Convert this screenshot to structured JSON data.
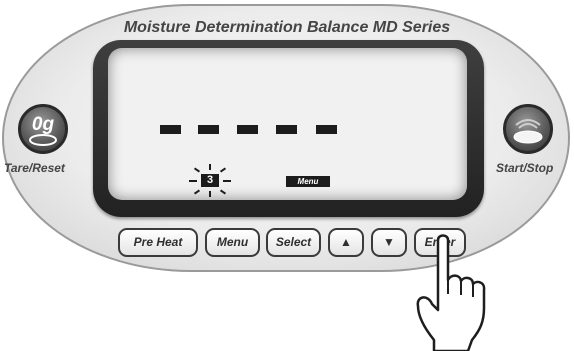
{
  "panel": {
    "title": "Moisture Determination Balance  MD Series"
  },
  "display": {
    "readout": "- - - - -",
    "program_number": "3",
    "menu_indicator": "Menu"
  },
  "left_button": {
    "icon_text": "0g",
    "label": "Tare/Reset"
  },
  "right_button": {
    "label": "Start/Stop"
  },
  "buttons": {
    "pre_heat": "Pre Heat",
    "menu": "Menu",
    "select": "Select",
    "up": "▲",
    "down": "▼",
    "enter": "Enter"
  },
  "icons": {
    "tare": "zero-gram-pan-icon",
    "start": "weighing-pan-icon",
    "pointer": "pointing-hand-icon"
  },
  "colors": {
    "panel": "#ececec",
    "display_frame": "#2e2e2e",
    "lcd": "#f1f1f1",
    "segments": "#1c1c1c"
  }
}
